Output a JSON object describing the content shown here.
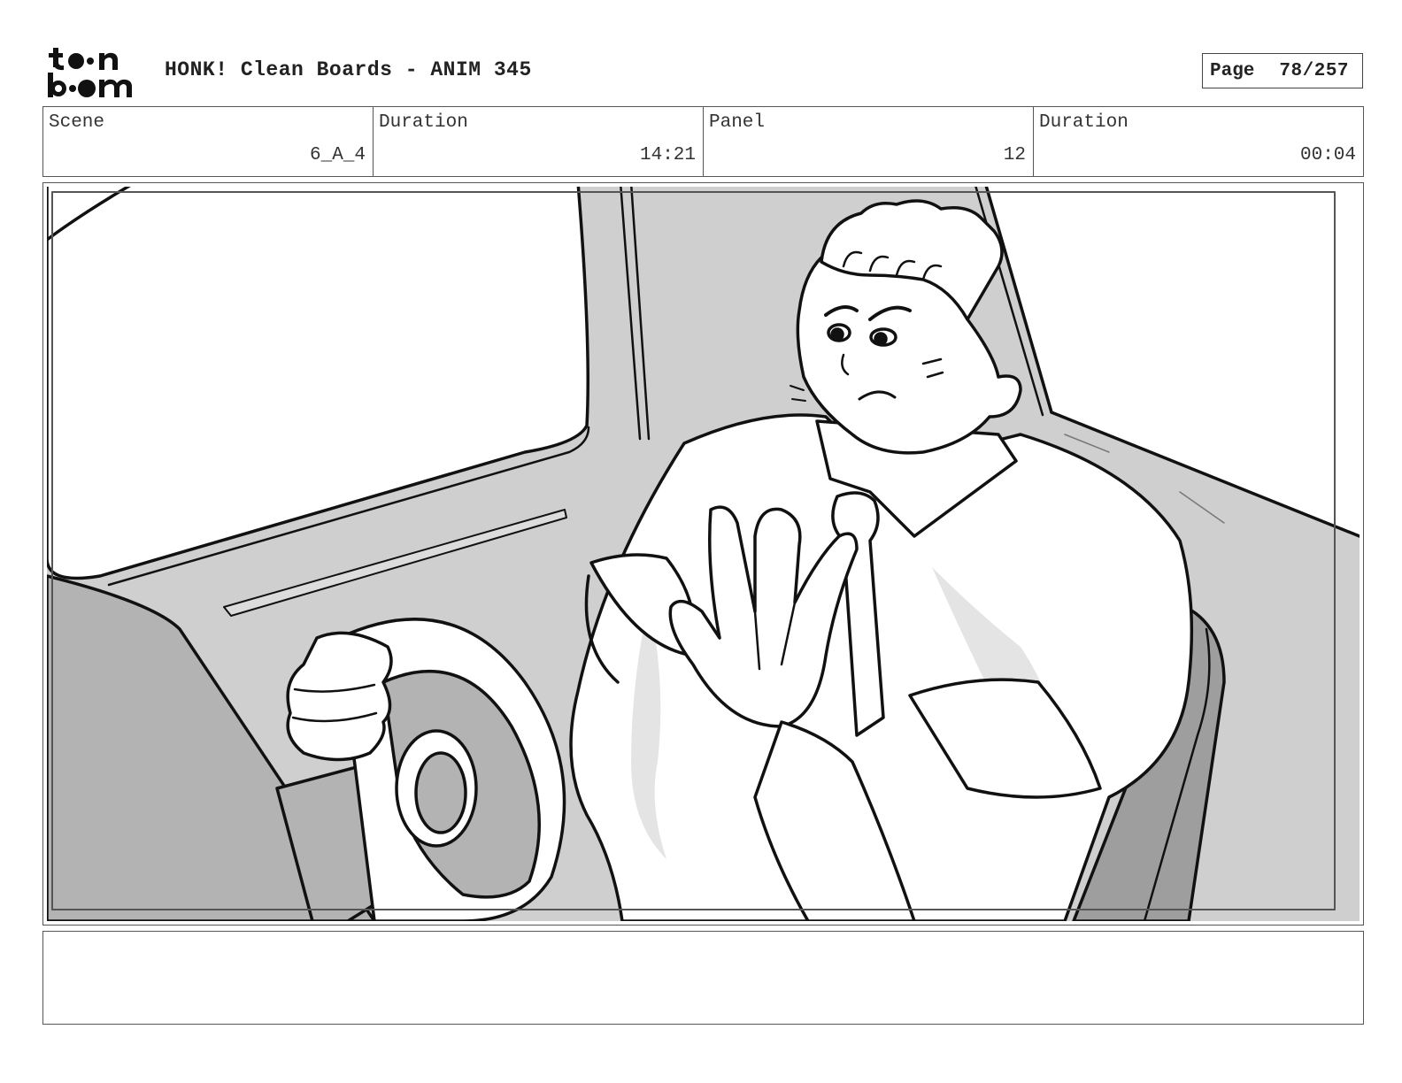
{
  "header": {
    "logo_top": "to•n",
    "logo_bottom": "b••m",
    "title": "HONK! Clean Boards - ANIM 345",
    "page_label": "Page",
    "page_number": "78/257"
  },
  "info": [
    {
      "label": "Scene",
      "value": "6_A_4"
    },
    {
      "label": "Duration",
      "value": "14:21"
    },
    {
      "label": "Panel",
      "value": "12"
    },
    {
      "label": "Duration",
      "value": "00:04"
    }
  ],
  "panel": {
    "colors": {
      "light_gray": "#cfcfcf",
      "mid_gray": "#b3b3b3",
      "dark_gray": "#9e9e9e",
      "line": "#111111"
    }
  },
  "notes": {
    "text": ""
  }
}
